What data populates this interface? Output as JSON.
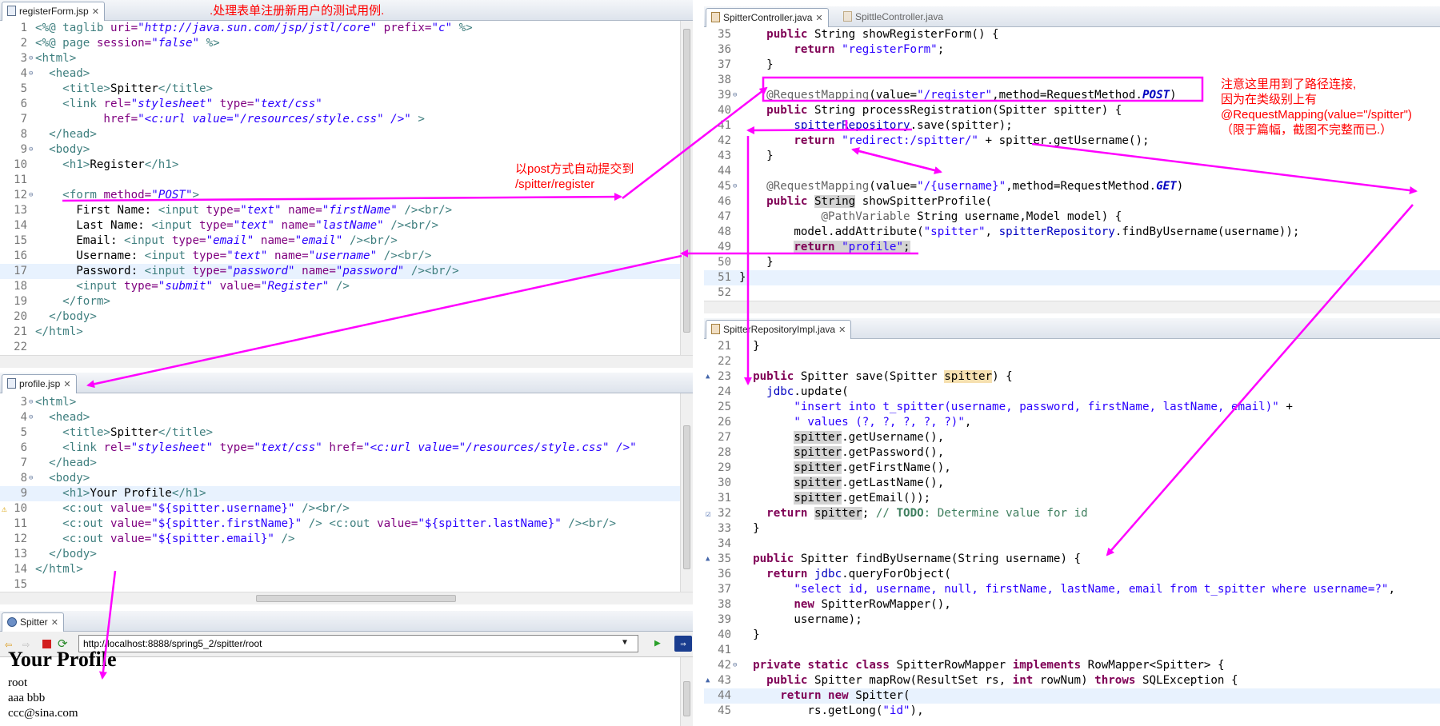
{
  "colors": {
    "annotation": "#ff00ff",
    "note_text": "#ff0000",
    "current_line": "#e8f2fe"
  },
  "registerForm": {
    "tab_label": "registerForm.jsp",
    "lines": [
      {
        "n": "1",
        "html": "<span class='tag'>&lt;%@ taglib</span> <span class='attr'>uri=</span><span class='val'>\"http://java.sun.com/jsp/jstl/core\"</span> <span class='attr'>prefix=</span><span class='val'>\"c\"</span> <span class='tag'>%&gt;</span>"
      },
      {
        "n": "2",
        "html": "<span class='tag'>&lt;%@ page</span> <span class='attr'>session=</span><span class='val'>\"false\"</span> <span class='tag'>%&gt;</span>"
      },
      {
        "n": "3",
        "fold": true,
        "html": "<span class='tag'>&lt;html&gt;</span>"
      },
      {
        "n": "4",
        "fold": true,
        "html": "  <span class='tag'>&lt;head&gt;</span>"
      },
      {
        "n": "5",
        "html": "    <span class='tag'>&lt;title&gt;</span>Spitter<span class='tag'>&lt;/title&gt;</span>"
      },
      {
        "n": "6",
        "html": "    <span class='tag'>&lt;link</span> <span class='attr'>rel=</span><span class='val'>\"stylesheet\"</span> <span class='attr'>type=</span><span class='val'>\"text/css\"</span>"
      },
      {
        "n": "7",
        "html": "          <span class='attr'>href=</span><span class='val'>\"&lt;c:url value=\"/resources/style.css\" /&gt;\"</span> <span class='tag'>&gt;</span>"
      },
      {
        "n": "8",
        "html": "  <span class='tag'>&lt;/head&gt;</span>"
      },
      {
        "n": "9",
        "fold": true,
        "html": "  <span class='tag'>&lt;body&gt;</span>"
      },
      {
        "n": "10",
        "html": "    <span class='tag'>&lt;h1&gt;</span>Register<span class='tag'>&lt;/h1&gt;</span>"
      },
      {
        "n": "11",
        "html": ""
      },
      {
        "n": "12",
        "fold": true,
        "html": "    <span class='tag'>&lt;form</span> <span class='attr'>method=</span><span class='val'>\"POST\"</span><span class='tag'>&gt;</span>"
      },
      {
        "n": "13",
        "html": "      First Name: <span class='tag'>&lt;input</span> <span class='attr'>type=</span><span class='val'>\"text\"</span> <span class='attr'>name=</span><span class='val'>\"firstName\"</span> <span class='tag'>/&gt;&lt;br/&gt;</span>"
      },
      {
        "n": "14",
        "html": "      Last Name: <span class='tag'>&lt;input</span> <span class='attr'>type=</span><span class='val'>\"text\"</span> <span class='attr'>name=</span><span class='val'>\"lastName\"</span> <span class='tag'>/&gt;&lt;br/&gt;</span>"
      },
      {
        "n": "15",
        "html": "      Email: <span class='tag'>&lt;input</span> <span class='attr'>type=</span><span class='val'>\"email\"</span> <span class='attr'>name=</span><span class='val'>\"email\"</span> <span class='tag'>/&gt;&lt;br/&gt;</span>"
      },
      {
        "n": "16",
        "html": "      Username: <span class='tag'>&lt;input</span> <span class='attr'>type=</span><span class='val'>\"text\"</span> <span class='attr'>name=</span><span class='val'>\"username\"</span> <span class='tag'>/&gt;&lt;br/&gt;</span>"
      },
      {
        "n": "17",
        "hl": true,
        "html": "      Password: <span class='tag'>&lt;input</span> <span class='attr'>type=</span><span class='val'>\"password\"</span> <span class='attr'>name=</span><span class='val'>\"password\"</span> <span class='tag'>/&gt;&lt;br/&gt;</span>"
      },
      {
        "n": "18",
        "html": "      <span class='tag'>&lt;input</span> <span class='attr'>type=</span><span class='val'>\"submit\"</span> <span class='attr'>value=</span><span class='val'>\"Register\"</span> <span class='tag'>/&gt;</span>"
      },
      {
        "n": "19",
        "html": "    <span class='tag'>&lt;/form&gt;</span>"
      },
      {
        "n": "20",
        "html": "  <span class='tag'>&lt;/body&gt;</span>"
      },
      {
        "n": "21",
        "html": "<span class='tag'>&lt;/html&gt;</span>"
      },
      {
        "n": "22",
        "html": ""
      }
    ]
  },
  "profile": {
    "tab_label": "profile.jsp",
    "lines": [
      {
        "n": "3",
        "fold": true,
        "html": "<span class='tag'>&lt;html&gt;</span>"
      },
      {
        "n": "4",
        "fold": true,
        "html": "  <span class='tag'>&lt;head&gt;</span>"
      },
      {
        "n": "5",
        "html": "    <span class='tag'>&lt;title&gt;</span>Spitter<span class='tag'>&lt;/title&gt;</span>"
      },
      {
        "n": "6",
        "html": "    <span class='tag'>&lt;link</span> <span class='attr'>rel=</span><span class='val'>\"stylesheet\"</span> <span class='attr'>type=</span><span class='val'>\"text/css\"</span> <span class='attr'>href=</span><span class='val'>\"&lt;c:url value=\"/resources/style.css\" /&gt;\"</span>"
      },
      {
        "n": "7",
        "html": "  <span class='tag'>&lt;/head&gt;</span>"
      },
      {
        "n": "8",
        "fold": true,
        "html": "  <span class='tag'>&lt;body&gt;</span>"
      },
      {
        "n": "9",
        "hl": true,
        "html": "    <span class='tag'>&lt;h1&gt;</span>Your Profile<span class='tag'>&lt;/h1&gt;</span>"
      },
      {
        "n": "10",
        "warn": true,
        "html": "    <span class='tag'>&lt;c:out</span> <span class='attr'>value=</span><span class='str'>\"${spitter.username}\"</span> <span class='tag'>/&gt;&lt;br/&gt;</span>"
      },
      {
        "n": "11",
        "html": "    <span class='tag'>&lt;c:out</span> <span class='attr'>value=</span><span class='str'>\"${spitter.firstName}\"</span> <span class='tag'>/&gt;</span> <span class='tag'>&lt;c:out</span> <span class='attr'>value=</span><span class='str'>\"${spitter.lastName}\"</span> <span class='tag'>/&gt;&lt;br/&gt;</span>"
      },
      {
        "n": "12",
        "html": "    <span class='tag'>&lt;c:out</span> <span class='attr'>value=</span><span class='str'>\"${spitter.email}\"</span> <span class='tag'>/&gt;</span>"
      },
      {
        "n": "13",
        "html": "  <span class='tag'>&lt;/body&gt;</span>"
      },
      {
        "n": "14",
        "html": "<span class='tag'>&lt;/html&gt;</span>"
      },
      {
        "n": "15",
        "html": ""
      }
    ]
  },
  "browser": {
    "tab_label": "Spitter",
    "url": "http://localhost:8888/spring5_2/spitter/root",
    "output": [
      "root",
      "aaa bbb",
      "ccc@sina.com"
    ]
  },
  "controller": {
    "tab_label": "SpitterController.java",
    "inactive_tab_label": "SpittleController.java",
    "lines": [
      {
        "n": "35",
        "html": "    <span class='kw'>public</span> String showRegisterForm() {"
      },
      {
        "n": "36",
        "html": "        <span class='kw'>return</span> <span class='str'>\"registerForm\"</span>;"
      },
      {
        "n": "37",
        "html": "    }"
      },
      {
        "n": "38",
        "html": ""
      },
      {
        "n": "39",
        "fold": true,
        "html": "    <span class='ann'>@RequestMapping</span>(value=<span class='str'>\"/register\"</span>,method=RequestMethod.<span class='fld'><b><i>POST</i></b></span>)"
      },
      {
        "n": "40",
        "html": "    <span class='kw'>public</span> String processRegistration(Spitter spitter) {"
      },
      {
        "n": "41",
        "html": "        <span class='fld'>spitterRepository</span>.save(spitter);"
      },
      {
        "n": "42",
        "html": "        <span class='kw'>return</span> <span class='str'>\"redirect:/spitter/\"</span> + spitter.getUsername();"
      },
      {
        "n": "43",
        "html": "    }"
      },
      {
        "n": "44",
        "html": ""
      },
      {
        "n": "45",
        "fold": true,
        "html": "    <span class='ann'>@RequestMapping</span>(value=<span class='str'>\"/{username}\"</span>,method=RequestMethod.<span class='fld'><b><i>GET</i></b></span>)"
      },
      {
        "n": "46",
        "html": "    <span class='kw'>public</span> <span class='ehl'>String</span> showSpitterProfile("
      },
      {
        "n": "47",
        "html": "            <span class='ann'>@PathVariable</span> String username,Model model) {"
      },
      {
        "n": "48",
        "html": "        model.addAttribute(<span class='str'>\"spitter\"</span>, <span class='fld'>spitterRepository</span>.findByUsername(username));"
      },
      {
        "n": "49",
        "html": "        <span class='ehl'><span class='kw'>return</span> <span class='str'>\"profile\"</span>;</span>"
      },
      {
        "n": "50",
        "html": "    }"
      },
      {
        "n": "51",
        "hl": true,
        "html": "}"
      },
      {
        "n": "52",
        "html": ""
      }
    ]
  },
  "repo": {
    "tab_label": "SpitterRepositoryImpl.java",
    "lines": [
      {
        "n": "21",
        "html": "  }"
      },
      {
        "n": "22",
        "html": ""
      },
      {
        "n": "23",
        "mark": true,
        "html": "  <span class='kw'>public</span> Spitter save(Spitter <span class='ohl'>spitter</span>) {"
      },
      {
        "n": "24",
        "html": "    <span class='fld'>jdbc</span>.update("
      },
      {
        "n": "25",
        "html": "        <span class='str'>\"insert into t_spitter(username, password, firstName, lastName, email)\"</span> +"
      },
      {
        "n": "26",
        "html": "        <span class='str'>\" values (?, ?, ?, ?, ?)\"</span>,"
      },
      {
        "n": "27",
        "html": "        <span class='ehl'>spitter</span>.getUsername(),"
      },
      {
        "n": "28",
        "html": "        <span class='ehl'>spitter</span>.getPassword(),"
      },
      {
        "n": "29",
        "html": "        <span class='ehl'>spitter</span>.getFirstName(),"
      },
      {
        "n": "30",
        "html": "        <span class='ehl'>spitter</span>.getLastName(),"
      },
      {
        "n": "31",
        "html": "        <span class='ehl'>spitter</span>.getEmail());"
      },
      {
        "n": "32",
        "task": true,
        "html": "    <span class='kw'>return</span> <span class='ehl'>spitter</span>; <span class='cmt'>// <b>TODO</b>: Determine value for id</span>"
      },
      {
        "n": "33",
        "html": "  }"
      },
      {
        "n": "34",
        "html": ""
      },
      {
        "n": "35",
        "mark": true,
        "html": "  <span class='kw'>public</span> Spitter findByUsername(String username) {"
      },
      {
        "n": "36",
        "html": "    <span class='kw'>return</span> <span class='fld'>jdbc</span>.queryForObject("
      },
      {
        "n": "37",
        "html": "        <span class='str'>\"select id, username, null, firstName, lastName, email from t_spitter where username=?\"</span>,"
      },
      {
        "n": "38",
        "html": "        <span class='kw'>new</span> SpitterRowMapper(),"
      },
      {
        "n": "39",
        "html": "        username);"
      },
      {
        "n": "40",
        "html": "  }"
      },
      {
        "n": "41",
        "html": ""
      },
      {
        "n": "42",
        "fold": true,
        "html": "  <span class='kw'>private</span> <span class='kw'>static</span> <span class='kw'>class</span> SpitterRowMapper <span class='kw'>implements</span> RowMapper&lt;Spitter&gt; {"
      },
      {
        "n": "43",
        "mark": true,
        "html": "    <span class='kw'>public</span> Spitter mapRow(ResultSet rs, <span class='kw'>int</span> rowNum) <span class='kw'>throws</span> SQLException {"
      },
      {
        "n": "44",
        "hl": true,
        "html": "      <span class='kw'>return</span> <span class='kw'>new</span> Spitter("
      },
      {
        "n": "45",
        "html": "          rs.getLong(<span class='str'>\"id\"</span>),"
      }
    ]
  },
  "notes": {
    "top": ".处理表单注册新用户的测试用例.",
    "post": "以post方式自动提交到\n/spitter/register",
    "path": "注意这里用到了路径连接,\n因为在类级别上有\n@RequestMapping(value=\"/spitter\")\n（限于篇幅，截图不完整而已.）"
  }
}
